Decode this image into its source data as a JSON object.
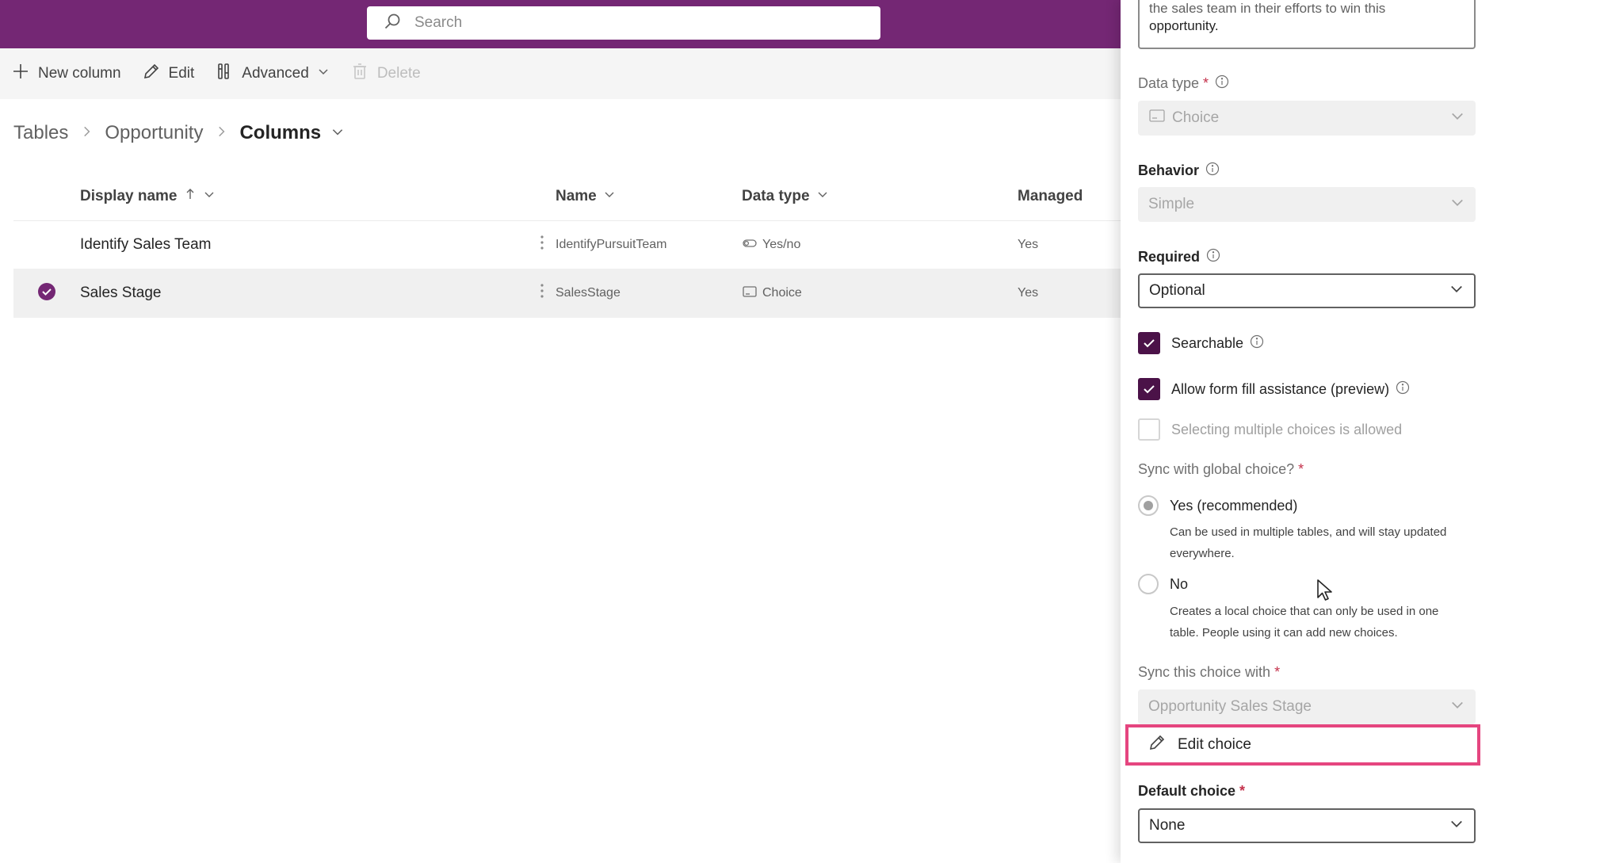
{
  "header": {
    "search_placeholder": "Search",
    "accent_color": "#742774"
  },
  "commandbar": {
    "new_column": "New column",
    "edit": "Edit",
    "advanced": "Advanced",
    "delete": "Delete"
  },
  "breadcrumb": {
    "items": [
      "Tables",
      "Opportunity"
    ],
    "current": "Columns"
  },
  "table": {
    "headers": {
      "display_name": "Display name",
      "name": "Name",
      "data_type": "Data type",
      "managed": "Managed"
    },
    "rows": [
      {
        "display_name": "Identify Sales Team",
        "name": "IdentifyPursuitTeam",
        "data_type": "Yes/no",
        "data_type_icon": "toggle-icon",
        "managed": "Yes",
        "selected": false
      },
      {
        "display_name": "Sales Stage",
        "name": "SalesStage",
        "data_type": "Choice",
        "data_type_icon": "choice-icon",
        "managed": "Yes",
        "selected": true
      }
    ]
  },
  "panel": {
    "description_partial": "the sales team in their efforts to win this",
    "description_end": "opportunity.",
    "data_type_label": "Data type",
    "data_type_value": "Choice",
    "behavior_label": "Behavior",
    "behavior_value": "Simple",
    "required_label": "Required",
    "required_value": "Optional",
    "searchable_label": "Searchable",
    "searchable_checked": true,
    "form_fill_label": "Allow form fill assistance (preview)",
    "form_fill_checked": true,
    "multiple_choices_label": "Selecting multiple choices is allowed",
    "multiple_choices_checked": false,
    "sync_global_label": "Sync with global choice?",
    "sync_yes_label": "Yes (recommended)",
    "sync_yes_desc_1": "Can be used in multiple tables, and will stay updated",
    "sync_yes_desc_2": "everywhere.",
    "sync_no_label": "No",
    "sync_no_desc_1": "Creates a local choice that can only be used in one",
    "sync_no_desc_2": "table. People using it can add new choices.",
    "sync_with_label": "Sync this choice with",
    "sync_with_value": "Opportunity Sales Stage",
    "edit_choice_label": "Edit choice",
    "default_choice_label": "Default choice",
    "default_choice_value": "None",
    "highlight_color": "#e5457f"
  }
}
